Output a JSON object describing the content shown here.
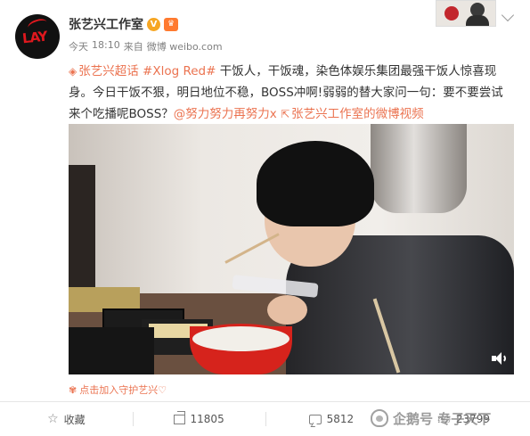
{
  "header": {
    "avatar_text": "LAY",
    "user_name": "张艺兴工作室",
    "verified_icon": "verified-v-icon",
    "member_icon": "crown-icon",
    "meta": {
      "day": "今天",
      "time": "18:10",
      "source_prefix": "来自",
      "source": "微博 weibo.com"
    }
  },
  "post": {
    "supertopic_icon": "supertopic-icon",
    "supertopic": "张艺兴超话",
    "hashtag": "#Xlog Red#",
    "text_1": " 干饭人，干饭魂，染色体娱乐集团最强干饭人惊喜现身。今日干饭不狠，明日地位不稳，BOSS冲啊!弱弱的替大家问一句：要不要尝试来个吃播呢BOSS？",
    "mention": "@努力努力再努力x",
    "video_link_icon": "video-link-icon",
    "video_link": "张艺兴工作室的微博视频"
  },
  "video": {
    "volume_icon": "volume-icon"
  },
  "guard": {
    "icon": "flower-icon",
    "label": "点击加入守护艺兴♡"
  },
  "actions": {
    "favorite_label": "收藏",
    "share_count": "11805",
    "comment_count": "5812",
    "like_count": "23799"
  },
  "watermark": {
    "text": "企鹅号 专子天下"
  },
  "colors": {
    "link": "#eb7350",
    "meta_gray": "#808080",
    "verified": "#f6a623"
  }
}
